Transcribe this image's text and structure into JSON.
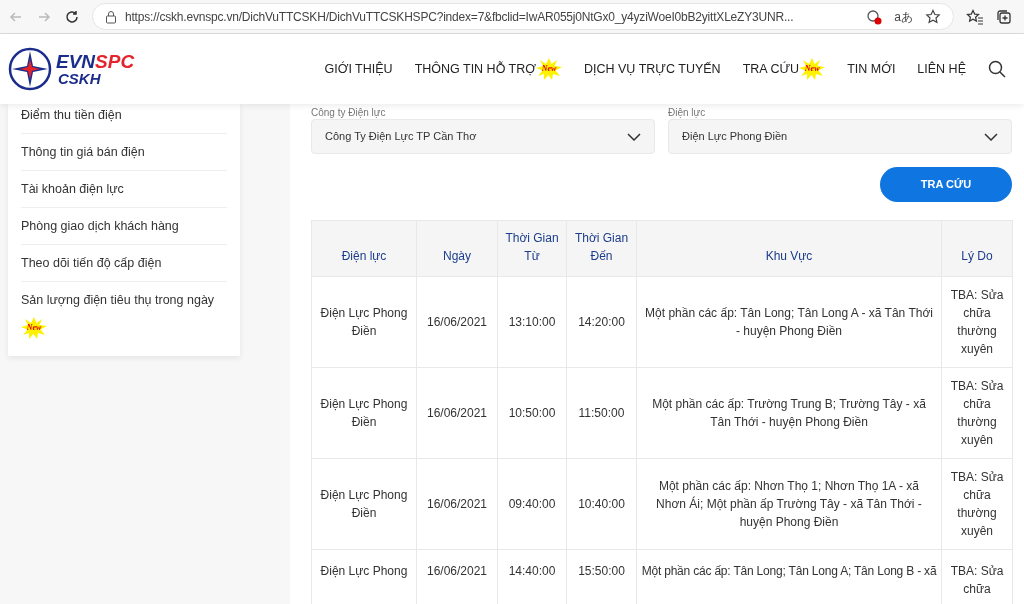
{
  "browser": {
    "url": "https://cskh.evnspc.vn/DichVuTTCSKH/DichVuTTCSKHSPC?index=7&fbclid=IwAR055j0NtGx0_y4yziWoeI0bB2yittXLeZY3UNR...",
    "read_aloud": "aあ"
  },
  "logo": {
    "brand_a": "EVN",
    "brand_b": "SPC",
    "sub": "CSKH"
  },
  "nav": [
    {
      "label": "GIỚI THIỆU"
    },
    {
      "label": "THÔNG TIN HỖ TRỢ",
      "badge": "New"
    },
    {
      "label": "DỊCH VỤ TRỰC TUYẾN"
    },
    {
      "label": "TRA CỨU",
      "badge": "New"
    },
    {
      "label": "TIN MỚI"
    },
    {
      "label": "LIÊN HỆ"
    }
  ],
  "sidebar": {
    "items": [
      {
        "label": "Điểm thu tiền điện"
      },
      {
        "label": "Thông tin giá bán điện"
      },
      {
        "label": "Tài khoản điện lực"
      },
      {
        "label": "Phòng giao dịch khách hàng"
      },
      {
        "label": "Theo dõi tiến độ cấp điện"
      },
      {
        "label": "Sản lượng điện tiêu thụ trong ngày",
        "badge": "New"
      }
    ]
  },
  "filters": [
    {
      "label": "Công ty Điện lực",
      "value": "Công Ty Điện Lực TP Cần Thơ"
    },
    {
      "label": "Điện lực",
      "value": "Điện Lực Phong Điền"
    }
  ],
  "search_button": "TRA CỨU",
  "table": {
    "columns": [
      "Điện lực",
      "Ngày",
      "Thời Gian Từ",
      "Thời Gian Đến",
      "Khu Vực",
      "Lý Do"
    ],
    "rows": [
      {
        "cells": [
          "Điện Lực Phong Điền",
          "16/06/2021",
          "13:10:00",
          "14:20:00",
          "Một phần các ấp: Tân Long; Tân Long A - xã Tân Thới - huyện Phong Điền",
          "TBA: Sửa chữa thường xuyên"
        ]
      },
      {
        "cells": [
          "Điện Lực Phong Điền",
          "16/06/2021",
          "10:50:00",
          "11:50:00",
          "Một phần các ấp: Trường Trung B; Trường Tây - xã Tân Thới - huyện Phong Điền",
          "TBA: Sửa chữa thường xuyên"
        ]
      },
      {
        "cells": [
          "Điện Lực Phong Điền",
          "16/06/2021",
          "09:40:00",
          "10:40:00",
          "Một phần các ấp: Nhơn Thọ 1; Nhơn Thọ 1A - xã Nhơn Ái; Một phần ấp Trường Tây - xã Tân Thới - huyện Phong Điền",
          "TBA: Sửa chữa thường xuyên"
        ]
      },
      {
        "cells": [
          "Điện Lực Phong",
          "16/06/2021",
          "14:40:00",
          "15:50:00",
          "Một phần các ấp: Tân Long; Tân Long A; Tân Long B - xã",
          "TBA: Sửa chữa"
        ]
      }
    ]
  }
}
